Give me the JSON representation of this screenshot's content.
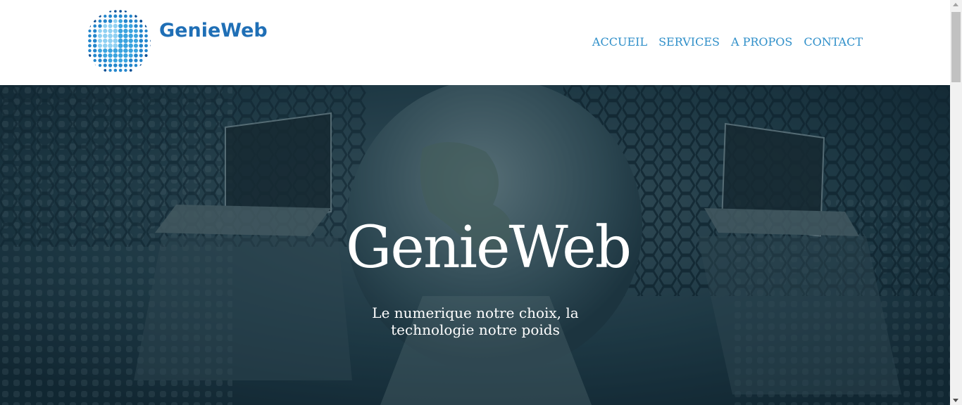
{
  "logo": {
    "text": "GenieWeb",
    "icon": "globe-dots-icon",
    "color": "#1f6fb6"
  },
  "nav": {
    "items": [
      {
        "label": "ACCUEIL"
      },
      {
        "label": "SERVICES"
      },
      {
        "label": "A PROPOS"
      },
      {
        "label": "CONTACT"
      }
    ],
    "color": "#2f8fc9"
  },
  "hero": {
    "title": "GenieWeb",
    "subtitle": "Le numerique notre choix, la technologie notre poids",
    "background": "network-globe-laptops-image",
    "overlay_color": "#1c3945"
  }
}
